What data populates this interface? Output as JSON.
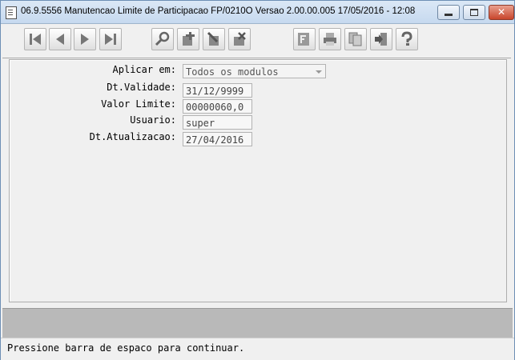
{
  "window": {
    "title": "06.9.5556 Manutencao  Limite de Participacao FP/0210O Versao 2.00.00.005 17/05/2016 - 12:08",
    "close_glyph": "✕"
  },
  "toolbar": {
    "icons": [
      "first-record-icon",
      "previous-record-icon",
      "next-record-icon",
      "last-record-icon",
      "search-icon",
      "add-icon",
      "edit-icon",
      "delete-icon",
      "filter-icon",
      "print-icon",
      "copy-icon",
      "exit-icon",
      "help-icon"
    ]
  },
  "form": {
    "aplicar_em": {
      "label": "Aplicar em:",
      "value": "Todos os modulos"
    },
    "dt_validade": {
      "label": "Dt.Validade:",
      "value": "31/12/9999"
    },
    "valor_limite": {
      "label": "Valor Limite:",
      "value": "00000060,0"
    },
    "usuario": {
      "label": "Usuario:",
      "value": "super"
    },
    "dt_atualizacao": {
      "label": "Dt.Atualizacao:",
      "value": "27/04/2016"
    }
  },
  "status_bar": {
    "message": "Pressione barra de espaco para continuar."
  },
  "colors": {
    "titlebar": "#c6d9ef",
    "close_button": "#c8452b",
    "panel": "#f0f0f0",
    "gray_bar": "#b9b9b9"
  }
}
